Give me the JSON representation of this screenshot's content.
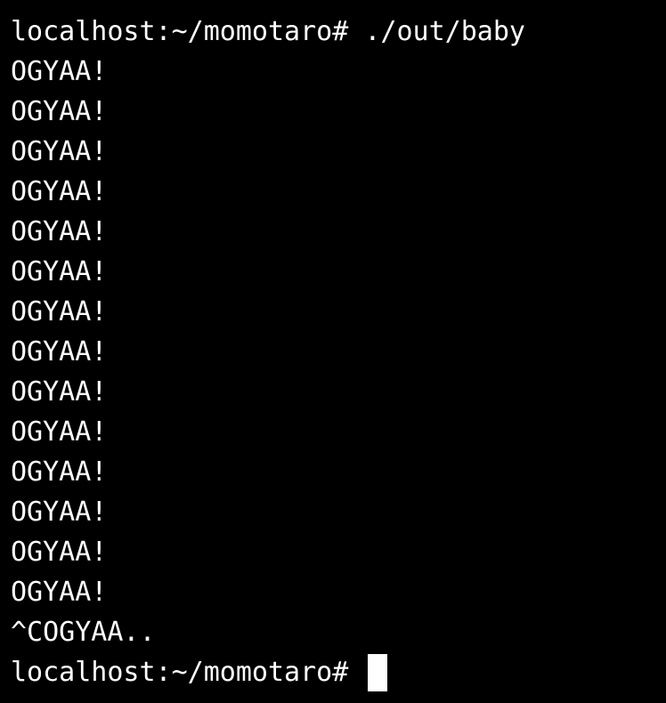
{
  "terminal": {
    "command_prompt": "localhost:~/momotaro#",
    "command": "./out/baby",
    "output_lines": [
      "OGYAA!",
      "OGYAA!",
      "OGYAA!",
      "OGYAA!",
      "OGYAA!",
      "OGYAA!",
      "OGYAA!",
      "OGYAA!",
      "OGYAA!",
      "OGYAA!",
      "OGYAA!",
      "OGYAA!",
      "OGYAA!",
      "OGYAA!"
    ],
    "interrupt_line": "^COGYAA..",
    "final_prompt": "localhost:~/momotaro#",
    "colors": {
      "background": "#000000",
      "foreground": "#ffffff",
      "cursor": "#ffffff"
    }
  }
}
